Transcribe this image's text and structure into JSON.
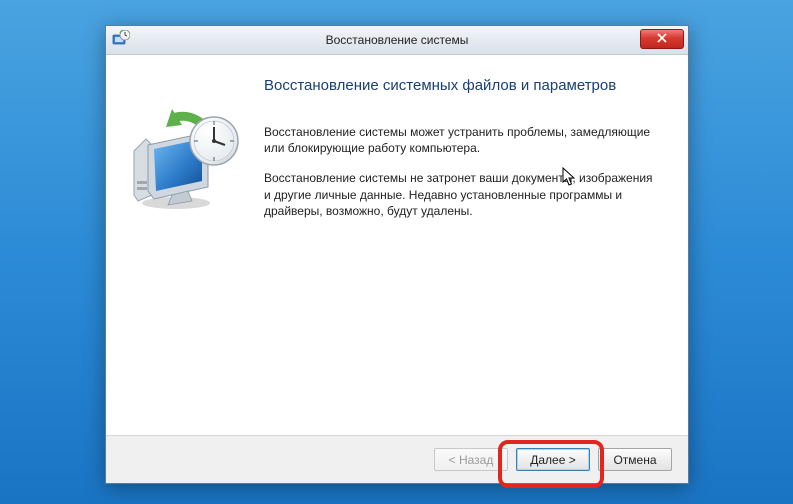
{
  "titlebar": {
    "title": "Восстановление системы"
  },
  "content": {
    "heading": "Восстановление системных файлов и параметров",
    "para1": "Восстановление системы может устранить проблемы, замедляющие или блокирующие работу компьютера.",
    "para2": "Восстановление системы не затронет ваши документы, изображения и другие личные данные. Недавно установленные программы и драйверы, возможно, будут удалены."
  },
  "footer": {
    "back_label": "< Назад",
    "next_label": "Далее >",
    "cancel_label": "Отмена"
  }
}
